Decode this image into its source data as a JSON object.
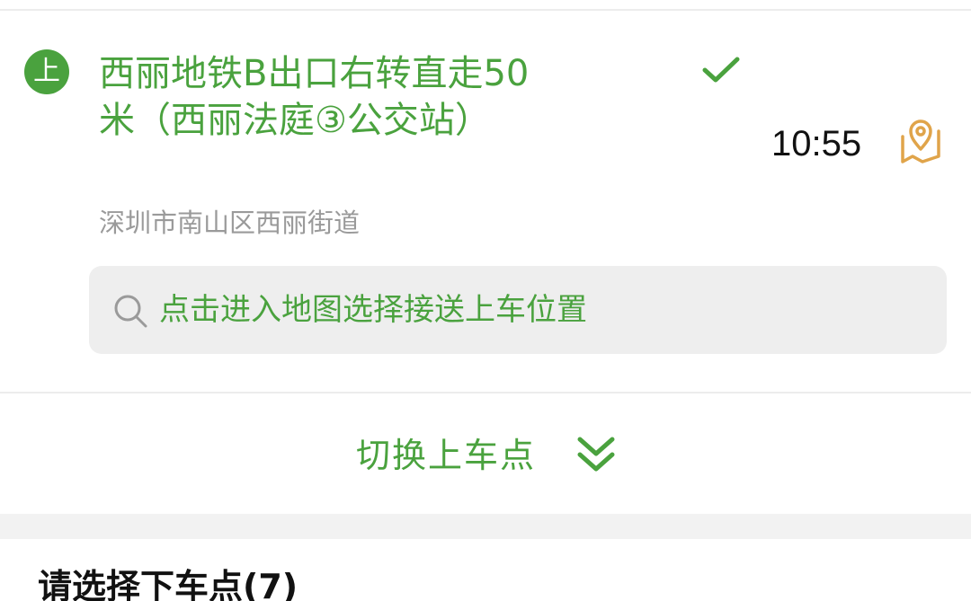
{
  "boarding": {
    "badge": "上",
    "stop_name": "西丽地铁B出口右转直走50米（西丽法庭③公交站）",
    "address": "深圳市南山区西丽街道",
    "time": "10:55",
    "icons": {
      "selected": "check-icon",
      "map": "map-pin-icon"
    },
    "accent_color": "#4aa23e",
    "map_icon_color": "#e0a44a"
  },
  "search": {
    "placeholder": "点击进入地图选择接送上车位置",
    "icon": "search-icon"
  },
  "switch": {
    "label": "切换上车点",
    "icon": "double-chevron-down-icon"
  },
  "dropoff": {
    "title": "请选择下车点(7)"
  }
}
